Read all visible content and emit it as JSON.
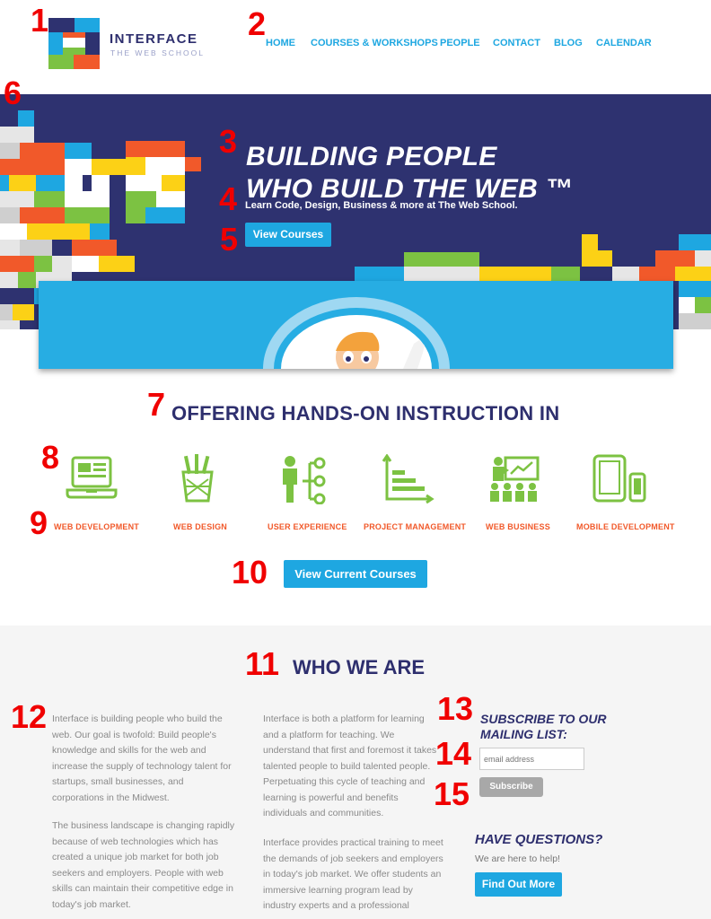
{
  "annotations": [
    "1",
    "2",
    "3",
    "4",
    "5",
    "6",
    "7",
    "8",
    "9",
    "10",
    "11",
    "12",
    "13",
    "14",
    "15"
  ],
  "header": {
    "logo_title": "INTERFACE",
    "logo_subtitle": "THE WEB SCHOOL",
    "nav": [
      "HOME",
      "COURSES & WORKSHOPS",
      "PEOPLE",
      "CONTACT",
      "BLOG",
      "CALENDAR"
    ]
  },
  "hero": {
    "title_line1": "BUILDING PEOPLE",
    "title_line2": "WHO BUILD THE WEB ™",
    "subtitle": "Learn Code, Design, Business & more at The Web School.",
    "button": "View Courses"
  },
  "offering": {
    "title": "OFFERING HANDS-ON INSTRUCTION IN",
    "courses": [
      {
        "label": "WEB DEVELOPMENT",
        "icon": "laptop-icon"
      },
      {
        "label": "WEB DESIGN",
        "icon": "pencil-cup-icon"
      },
      {
        "label": "USER EXPERIENCE",
        "icon": "user-flow-icon"
      },
      {
        "label": "PROJECT MANAGEMENT",
        "icon": "gantt-chart-icon"
      },
      {
        "label": "WEB BUSINESS",
        "icon": "presentation-icon"
      },
      {
        "label": "MOBILE DEVELOPMENT",
        "icon": "mobile-devices-icon"
      }
    ],
    "button": "View Current Courses"
  },
  "who": {
    "title": "WHO WE ARE",
    "col1": {
      "p1": "Interface is building people who build the web. Our goal is twofold: Build people's knowledge and skills for the web and increase the supply of technology talent for startups, small businesses, and corporations in the Midwest.",
      "p2": "The business landscape is changing rapidly because of web technologies which has created a unique job market for both job seekers and employers. People with web skills can maintain their competitive edge in today's job market."
    },
    "col2": {
      "p1": "Interface is both a platform for learning and a platform for teaching. We understand that first and foremost it takes talented people to build talented people. Perpetuating this cycle of teaching and learning is powerful and benefits individuals and communities.",
      "p2": "Interface provides practical training to meet the demands of job seekers and employers in today's job market. We offer students an immersive learning program lead by industry experts and a professional"
    },
    "subscribe": {
      "title": "SUBSCRIBE TO OUR MAILING LIST:",
      "placeholder": "email address",
      "button": "Subscribe"
    },
    "questions": {
      "title": "HAVE QUESTIONS?",
      "subtitle": "We are here to help!",
      "button": "Find Out More"
    }
  },
  "colors": {
    "navy": "#2e2f6e",
    "hero_bg": "#2e3270",
    "accent_blue": "#1ea7e1",
    "orange": "#f1592a",
    "green": "#7cc242",
    "yellow": "#fcd116",
    "annotation_red": "#f00000"
  }
}
